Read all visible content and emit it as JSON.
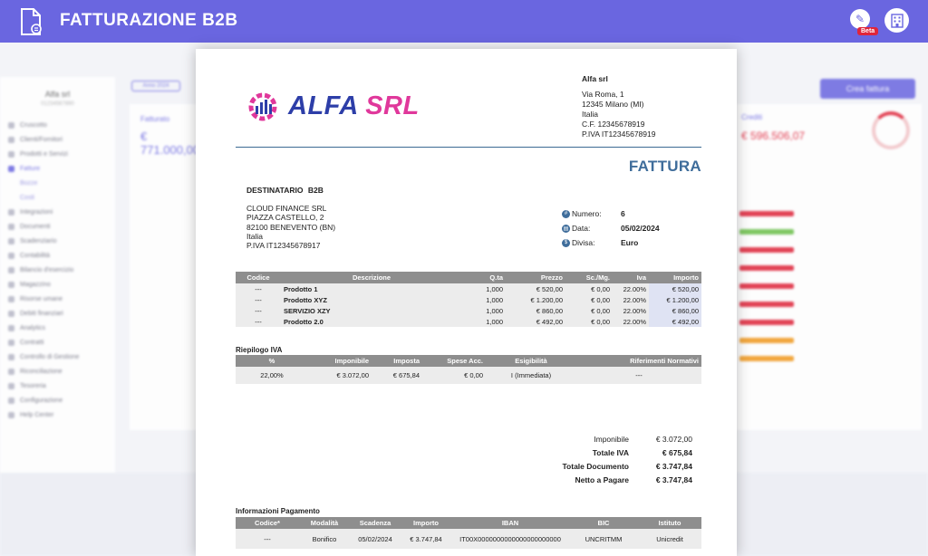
{
  "header": {
    "title": "FATTURAZIONE B2B",
    "beta_badge": "Beta",
    "accent_color": "#6a66e0"
  },
  "background": {
    "company": "Alfa srl",
    "company_sub": "01234567890",
    "year_button": "Anno 2024",
    "create_button": "Crea fattura",
    "fatturato_label": "Fatturato",
    "fatturato_value": "€ 771.000,00",
    "crediti_label": "Crediti",
    "crediti_value": "€ 596.506,07",
    "ring_percent": "66%",
    "sidebar_items": [
      "Cruscotto",
      "Clienti/Fornitori",
      "Prodotti e Servizi",
      "Fatture",
      "Bozze",
      "Costi",
      "Integrazioni",
      "Documenti",
      "Scadenziario",
      "Contabilità",
      "Bilancio d'esercizio",
      "Magazzino",
      "Risorse umane",
      "Debiti finanziari",
      "Analytics",
      "Contratti",
      "Controllo di Gestione",
      "Riconciliazione",
      "Tesoreria",
      "Configurazione",
      "Help Center"
    ]
  },
  "invoice": {
    "logo_text_1": "ALFA",
    "logo_text_2": "SRL",
    "sender": {
      "name": "Alfa srl",
      "line1": "Via Roma, 1",
      "line2": "12345 Milano (MI)",
      "line3": "Italia",
      "line4": "C.F. 12345678919",
      "line5": "P.IVA IT12345678919"
    },
    "doc_title": "FATTURA",
    "dest_label": "DESTINATARIO",
    "dest_type": "B2B",
    "dest": {
      "line1": "CLOUD FINANCE SRL",
      "line2": "PIAZZA CASTELLO, 2",
      "line3": "82100 BENEVENTO (BN)",
      "line4": "Italia",
      "line5": "P.IVA IT12345678917"
    },
    "meta": {
      "numero_label": "Numero:",
      "numero_value": "6",
      "data_label": "Data:",
      "data_value": "05/02/2024",
      "divisa_label": "Divisa:",
      "divisa_value": "Euro"
    },
    "items_headers": [
      "Codice",
      "Descrizione",
      "Q.ta",
      "Prezzo",
      "Sc./Mg.",
      "Iva",
      "Importo"
    ],
    "items": [
      [
        "---",
        "Prodotto 1",
        "1,000",
        "€ 520,00",
        "€ 0,00",
        "22.00%",
        "€ 520,00"
      ],
      [
        "---",
        "Prodotto XYZ",
        "1,000",
        "€ 1.200,00",
        "€ 0,00",
        "22.00%",
        "€ 1.200,00"
      ],
      [
        "---",
        "SERVIZIO XZY",
        "1,000",
        "€ 860,00",
        "€ 0,00",
        "22.00%",
        "€ 860,00"
      ],
      [
        "---",
        "Prodotto 2.0",
        "1,000",
        "€ 492,00",
        "€ 0,00",
        "22.00%",
        "€ 492,00"
      ]
    ],
    "riepilogo_title": "Riepilogo IVA",
    "riep_headers": [
      "%",
      "Imponibile",
      "Imposta",
      "Spese Acc.",
      "Esigibilità",
      "Riferimenti Normativi"
    ],
    "riep_row": [
      "22,00%",
      "€ 3.072,00",
      "€ 675,84",
      "€ 0,00",
      "I (Immediata)",
      "---"
    ],
    "totals": {
      "imponibile_label": "Imponibile",
      "imponibile_value": "€ 3.072,00",
      "iva_label": "Totale IVA",
      "iva_value": "€ 675,84",
      "documento_label": "Totale Documento",
      "documento_value": "€ 3.747,84",
      "netto_label": "Netto a Pagare",
      "netto_value": "€ 3.747,84"
    },
    "pay_title": "Informazioni Pagamento",
    "pay_headers": [
      "Codice*",
      "Modalità",
      "Scadenza",
      "Importo",
      "IBAN",
      "BIC",
      "Istituto"
    ],
    "pay_row": [
      "---",
      "Bonifico",
      "05/02/2024",
      "€ 3.747,84",
      "IT00X0000000000000000000000",
      "UNCRITMM",
      "Unicredit"
    ]
  }
}
